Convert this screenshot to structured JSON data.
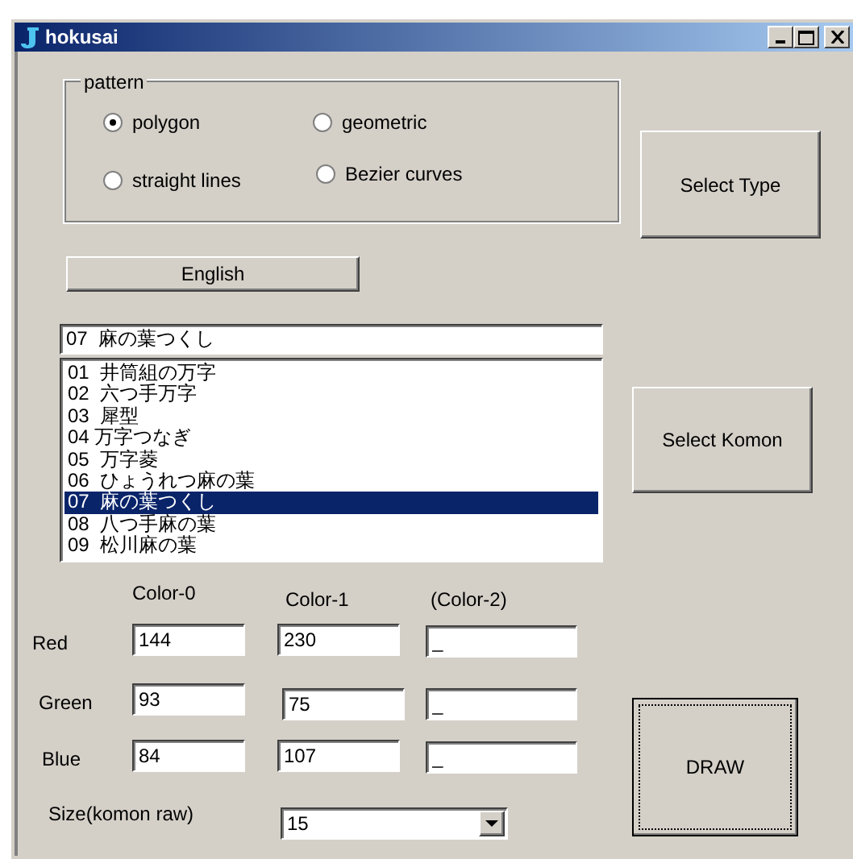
{
  "window": {
    "title": "hokusai"
  },
  "pattern": {
    "legend": "pattern",
    "options": [
      {
        "label": "polygon",
        "selected": true
      },
      {
        "label": "geometric",
        "selected": false
      },
      {
        "label": "straight lines",
        "selected": false
      },
      {
        "label": "Bezier curves",
        "selected": false
      }
    ]
  },
  "select_type_button": "Select Type",
  "language_button": "English",
  "komon_combo": {
    "value": "07  麻の葉つくし"
  },
  "komon_list": [
    {
      "label": "01  井筒組の万字",
      "selected": false
    },
    {
      "label": "02  六つ手万字",
      "selected": false
    },
    {
      "label": "03  犀型",
      "selected": false
    },
    {
      "label": "04 万字つなぎ",
      "selected": false
    },
    {
      "label": "05  万字菱",
      "selected": false
    },
    {
      "label": "06  ひょうれつ麻の葉",
      "selected": false
    },
    {
      "label": "07  麻の葉つくし",
      "selected": true
    },
    {
      "label": "08  八つ手麻の葉",
      "selected": false
    },
    {
      "label": "09  松川麻の葉",
      "selected": false
    }
  ],
  "select_komon_button": "Select Komon",
  "color_headers": [
    "Color-0",
    "Color-1",
    "(Color-2)"
  ],
  "color_rows": [
    {
      "label": "Red",
      "values": [
        "144",
        "230",
        "_"
      ]
    },
    {
      "label": "Green",
      "values": [
        "93",
        "75",
        "_"
      ]
    },
    {
      "label": "Blue",
      "values": [
        "84",
        "107",
        "_"
      ]
    }
  ],
  "size": {
    "label": "Size(komon raw)",
    "value": "15"
  },
  "draw_button": "DRAW"
}
